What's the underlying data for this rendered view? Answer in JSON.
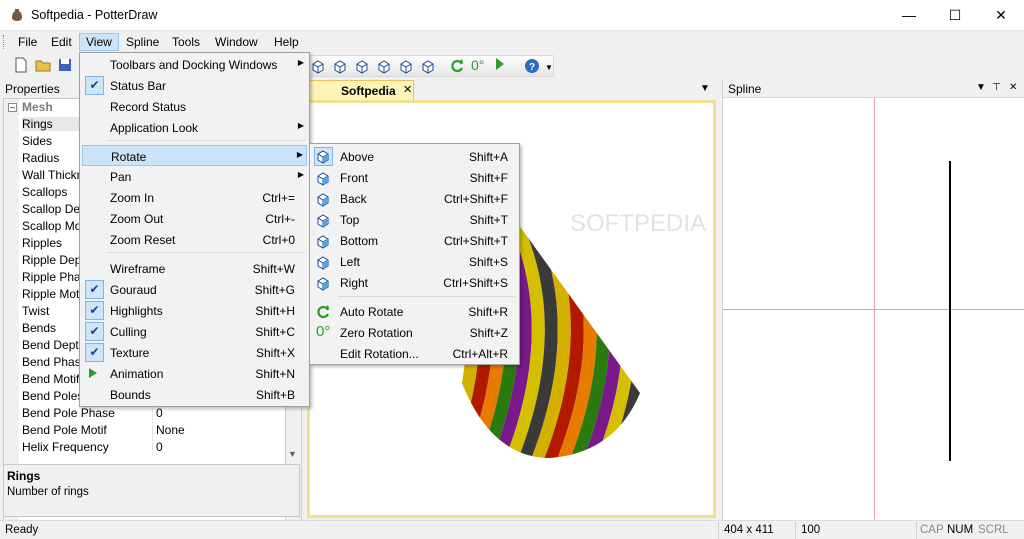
{
  "window": {
    "title": "Softpedia - PotterDraw"
  },
  "menubar": [
    "File",
    "Edit",
    "View",
    "Spline",
    "Tools",
    "Window",
    "Help"
  ],
  "toolbar": {
    "rotation_readout": "0°"
  },
  "properties": {
    "title": "Properties",
    "category": "Mesh",
    "rows": [
      {
        "name": "Rings",
        "value": ""
      },
      {
        "name": "Sides",
        "value": ""
      },
      {
        "name": "Radius",
        "value": ""
      },
      {
        "name": "Wall Thickn",
        "value": ""
      },
      {
        "name": "Scallops",
        "value": ""
      },
      {
        "name": "Scallop Dep",
        "value": ""
      },
      {
        "name": "Scallop Moti",
        "value": ""
      },
      {
        "name": "Ripples",
        "value": ""
      },
      {
        "name": "Ripple Depth",
        "value": ""
      },
      {
        "name": "Ripple Phas",
        "value": ""
      },
      {
        "name": "Ripple Motif",
        "value": ""
      },
      {
        "name": "Twist",
        "value": ""
      },
      {
        "name": "Bends",
        "value": ""
      },
      {
        "name": "Bend Depth",
        "value": ""
      },
      {
        "name": "Bend Phase",
        "value": ""
      },
      {
        "name": "Bend Motif",
        "value": ""
      },
      {
        "name": "Bend Poles",
        "value": ""
      },
      {
        "name": "Bend Pole Phase",
        "value": "0"
      },
      {
        "name": "Bend Pole Motif",
        "value": "None"
      },
      {
        "name": "Helix Frequency",
        "value": "0"
      }
    ],
    "description": {
      "title": "Rings",
      "text": "Number of rings"
    }
  },
  "document": {
    "tab_title": "Softpedia",
    "watermark": "SOFTPEDIA"
  },
  "spline": {
    "title": "Spline"
  },
  "statusbar": {
    "ready": "Ready",
    "size": "404 x 411",
    "zoom": "100",
    "cap": "CAP",
    "num": "NUM",
    "scrl": "SCRL"
  },
  "view_menu": [
    {
      "label": "Toolbars and Docking Windows",
      "shortcut": "",
      "submenu": true
    },
    {
      "label": "Status Bar",
      "shortcut": "",
      "checked": true
    },
    {
      "label": "Record Status",
      "shortcut": ""
    },
    {
      "label": "Application Look",
      "shortcut": "",
      "submenu": true
    },
    {
      "label": "Rotate",
      "shortcut": "",
      "submenu": true,
      "highlighted": true
    },
    {
      "label": "Pan",
      "shortcut": "",
      "submenu": true
    },
    {
      "label": "Zoom In",
      "shortcut": "Ctrl+="
    },
    {
      "label": "Zoom Out",
      "shortcut": "Ctrl+-"
    },
    {
      "label": "Zoom Reset",
      "shortcut": "Ctrl+0"
    },
    {
      "label": "Wireframe",
      "shortcut": "Shift+W"
    },
    {
      "label": "Gouraud",
      "shortcut": "Shift+G",
      "checked": true
    },
    {
      "label": "Highlights",
      "shortcut": "Shift+H",
      "checked": true
    },
    {
      "label": "Culling",
      "shortcut": "Shift+C",
      "checked": true
    },
    {
      "label": "Texture",
      "shortcut": "Shift+X",
      "checked": true
    },
    {
      "label": "Animation",
      "shortcut": "Shift+N"
    },
    {
      "label": "Bounds",
      "shortcut": "Shift+B"
    }
  ],
  "rotate_menu": [
    {
      "label": "Above",
      "shortcut": "Shift+A"
    },
    {
      "label": "Front",
      "shortcut": "Shift+F"
    },
    {
      "label": "Back",
      "shortcut": "Ctrl+Shift+F"
    },
    {
      "label": "Top",
      "shortcut": "Shift+T"
    },
    {
      "label": "Bottom",
      "shortcut": "Ctrl+Shift+T"
    },
    {
      "label": "Left",
      "shortcut": "Shift+S"
    },
    {
      "label": "Right",
      "shortcut": "Ctrl+Shift+S"
    },
    {
      "label": "Auto Rotate",
      "shortcut": "Shift+R"
    },
    {
      "label": "Zero Rotation",
      "shortcut": "Shift+Z"
    },
    {
      "label": "Edit Rotation...",
      "shortcut": "Ctrl+Alt+R"
    }
  ],
  "colors": {
    "accent": "#cce4f7",
    "tab": "#fff4b8",
    "axis": "#e7a0a0"
  },
  "cone_stripes": [
    "#d4b000",
    "#b21a00",
    "#e87a00",
    "#2a7a10",
    "#7a1a8a",
    "#d4c000",
    "#3a3a3a"
  ]
}
